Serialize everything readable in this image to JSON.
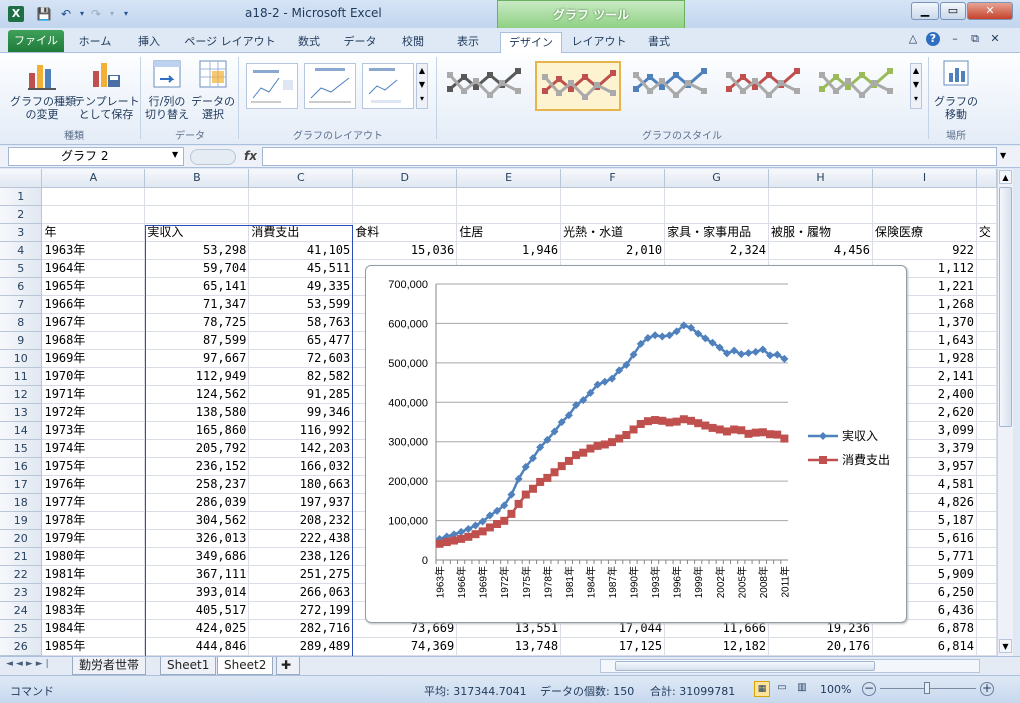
{
  "window": {
    "title": "a18-2 - Microsoft Excel",
    "context_tool": "グラフ ツール",
    "app_icon": "X"
  },
  "tabs": [
    "ファイル",
    "ホーム",
    "挿入",
    "ページ レイアウト",
    "数式",
    "データ",
    "校閲",
    "表示",
    "デザイン",
    "レイアウト",
    "書式"
  ],
  "ribbon": {
    "change_type": "グラフの種類\nの変更",
    "save_template": "テンプレート\nとして保存",
    "group_type": "種類",
    "switch_row_col": "行/列の\n切り替え",
    "select_data": "データの\n選択",
    "group_data": "データ",
    "group_layout": "グラフのレイアウト",
    "group_style": "グラフのスタイル",
    "move_chart": "グラフの\n移動",
    "group_location": "場所",
    "style_colors": [
      "#595959",
      "#c0504d",
      "#4f81bd",
      "#c0504d",
      "#9bbb59"
    ]
  },
  "formula_bar": {
    "name_box": "グラフ 2",
    "fx": "fx",
    "formula": ""
  },
  "sheet": {
    "columns": [
      "A",
      "B",
      "C",
      "D",
      "E",
      "F",
      "G",
      "H",
      "I"
    ],
    "rows": [
      {
        "n": "1",
        "c": [
          "",
          "",
          "",
          "",
          "",
          "",
          "",
          "",
          ""
        ]
      },
      {
        "n": "2",
        "c": [
          "",
          "",
          "",
          "",
          "",
          "",
          "",
          "",
          ""
        ]
      },
      {
        "n": "3",
        "c": [
          "年",
          "実収入",
          "消費支出",
          "食料",
          "住居",
          "光熱・水道",
          "家具・家事用品",
          "被服・履物",
          "保険医療"
        ]
      },
      {
        "n": "4",
        "c": [
          "1963年",
          "53,298",
          "41,105",
          "15,036",
          "1,946",
          "2,010",
          "2,324",
          "4,456",
          "922"
        ]
      },
      {
        "n": "5",
        "c": [
          "1964年",
          "59,704",
          "45,511",
          "",
          "",
          "",
          "",
          "",
          "1,112"
        ]
      },
      {
        "n": "6",
        "c": [
          "1965年",
          "65,141",
          "49,335",
          "",
          "",
          "",
          "",
          "",
          "1,221"
        ]
      },
      {
        "n": "7",
        "c": [
          "1966年",
          "71,347",
          "53,599",
          "",
          "",
          "",
          "",
          "",
          "1,268"
        ]
      },
      {
        "n": "8",
        "c": [
          "1967年",
          "78,725",
          "58,763",
          "",
          "",
          "",
          "",
          "",
          "1,370"
        ]
      },
      {
        "n": "9",
        "c": [
          "1968年",
          "87,599",
          "65,477",
          "",
          "",
          "",
          "",
          "",
          "1,643"
        ]
      },
      {
        "n": "10",
        "c": [
          "1969年",
          "97,667",
          "72,603",
          "",
          "",
          "",
          "",
          "",
          "1,928"
        ]
      },
      {
        "n": "11",
        "c": [
          "1970年",
          "112,949",
          "82,582",
          "",
          "",
          "",
          "",
          "",
          "2,141"
        ]
      },
      {
        "n": "12",
        "c": [
          "1971年",
          "124,562",
          "91,285",
          "",
          "",
          "",
          "",
          "",
          "2,400"
        ]
      },
      {
        "n": "13",
        "c": [
          "1972年",
          "138,580",
          "99,346",
          "",
          "",
          "",
          "",
          "",
          "2,620"
        ]
      },
      {
        "n": "14",
        "c": [
          "1973年",
          "165,860",
          "116,992",
          "",
          "",
          "",
          "",
          "",
          "3,099"
        ]
      },
      {
        "n": "15",
        "c": [
          "1974年",
          "205,792",
          "142,203",
          "",
          "",
          "",
          "",
          "",
          "3,379"
        ]
      },
      {
        "n": "16",
        "c": [
          "1975年",
          "236,152",
          "166,032",
          "",
          "",
          "",
          "",
          "",
          "3,957"
        ]
      },
      {
        "n": "17",
        "c": [
          "1976年",
          "258,237",
          "180,663",
          "",
          "",
          "",
          "",
          "",
          "4,581"
        ]
      },
      {
        "n": "18",
        "c": [
          "1977年",
          "286,039",
          "197,937",
          "",
          "",
          "",
          "",
          "",
          "4,826"
        ]
      },
      {
        "n": "19",
        "c": [
          "1978年",
          "304,562",
          "208,232",
          "",
          "",
          "",
          "",
          "",
          "5,187"
        ]
      },
      {
        "n": "20",
        "c": [
          "1979年",
          "326,013",
          "222,438",
          "",
          "",
          "",
          "",
          "",
          "5,616"
        ]
      },
      {
        "n": "21",
        "c": [
          "1980年",
          "349,686",
          "238,126",
          "",
          "",
          "",
          "",
          "",
          "5,771"
        ]
      },
      {
        "n": "22",
        "c": [
          "1981年",
          "367,111",
          "251,275",
          "",
          "",
          "",
          "",
          "",
          "5,909"
        ]
      },
      {
        "n": "23",
        "c": [
          "1982年",
          "393,014",
          "266,063",
          "",
          "",
          "",
          "",
          "",
          "6,250"
        ]
      },
      {
        "n": "24",
        "c": [
          "1983年",
          "405,517",
          "272,199",
          "",
          "",
          "",
          "",
          "",
          "6,436"
        ]
      },
      {
        "n": "25",
        "c": [
          "1984年",
          "424,025",
          "282,716",
          "73,669",
          "13,551",
          "17,044",
          "11,666",
          "19,236",
          "6,878"
        ]
      },
      {
        "n": "26",
        "c": [
          "1985年",
          "444,846",
          "289,489",
          "74,369",
          "13,748",
          "17,125",
          "12,182",
          "20,176",
          "6,814"
        ]
      }
    ],
    "col_j_header_text": "交"
  },
  "chart_data": {
    "type": "line",
    "x": [
      "1963年",
      "1964年",
      "1965年",
      "1966年",
      "1967年",
      "1968年",
      "1969年",
      "1970年",
      "1971年",
      "1972年",
      "1973年",
      "1974年",
      "1975年",
      "1976年",
      "1977年",
      "1978年",
      "1979年",
      "1980年",
      "1981年",
      "1982年",
      "1983年",
      "1984年",
      "1985年",
      "1986年",
      "1987年",
      "1988年",
      "1989年",
      "1990年",
      "1991年",
      "1992年",
      "1993年",
      "1994年",
      "1995年",
      "1996年",
      "1997年",
      "1998年",
      "1999年",
      "2000年",
      "2001年",
      "2002年",
      "2003年",
      "2004年",
      "2005年",
      "2006年",
      "2007年",
      "2008年",
      "2009年",
      "2010年",
      "2011年"
    ],
    "tick_labels": [
      "1963年",
      "1966年",
      "1969年",
      "1972年",
      "1975年",
      "1978年",
      "1981年",
      "1984年",
      "1987年",
      "1990年",
      "1993年",
      "1996年",
      "1999年",
      "2002年",
      "2005年",
      "2008年",
      "2011年"
    ],
    "series": [
      {
        "name": "実収入",
        "color": "#4f81bd",
        "marker": "diamond",
        "values": [
          53298,
          59704,
          65141,
          71347,
          78725,
          87599,
          97667,
          112949,
          124562,
          138580,
          165860,
          205792,
          236152,
          258237,
          286039,
          304562,
          326013,
          349686,
          367111,
          393014,
          405517,
          424025,
          444846,
          452000,
          460000,
          481000,
          495000,
          521000,
          548000,
          563000,
          570000,
          567000,
          570000,
          580000,
          595000,
          589000,
          574000,
          562000,
          551000,
          539000,
          524000,
          531000,
          522000,
          525000,
          528000,
          534000,
          519000,
          521000,
          510000
        ]
      },
      {
        "name": "消費支出",
        "color": "#c0504d",
        "marker": "square",
        "values": [
          41105,
          45511,
          49335,
          53599,
          58763,
          65477,
          72603,
          82582,
          91285,
          99346,
          116992,
          142203,
          166032,
          180663,
          197937,
          208232,
          222438,
          238126,
          251275,
          266063,
          272199,
          282716,
          289489,
          293000,
          299000,
          308000,
          317000,
          331000,
          345000,
          352000,
          355000,
          353000,
          349000,
          351000,
          357000,
          353000,
          347000,
          341000,
          335000,
          331000,
          326000,
          331000,
          329000,
          320000,
          323000,
          324000,
          319000,
          318000,
          308000
        ]
      }
    ],
    "yticks": [
      "700,000",
      "600,000",
      "500,000",
      "400,000",
      "300,000",
      "200,000",
      "100,000",
      "0"
    ],
    "ylim": [
      0,
      700000
    ],
    "legend_position": "right",
    "grid": true
  },
  "sheet_tabs": [
    "勤労者世帯",
    "Sheet1",
    "Sheet2"
  ],
  "active_sheet_tab": "Sheet2",
  "status": {
    "mode": "コマンド",
    "average": "平均: 317344.7041",
    "count": "データの個数: 150",
    "sum": "合計: 31099781",
    "zoom": "100%"
  }
}
